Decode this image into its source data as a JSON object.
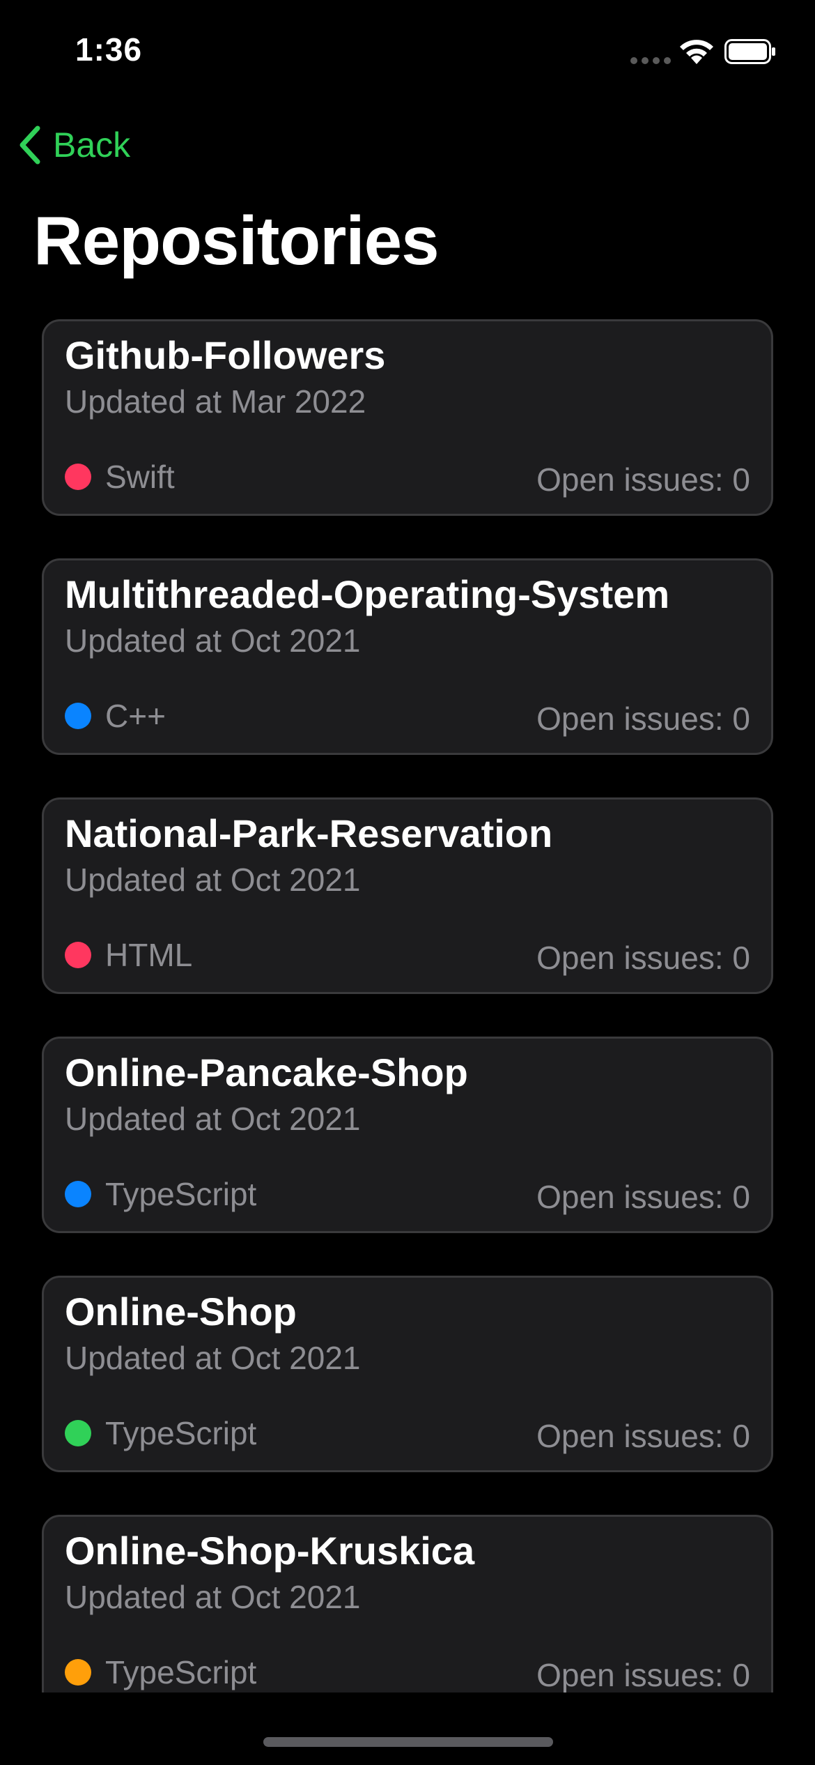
{
  "status_bar": {
    "time": "1:36"
  },
  "nav": {
    "back_label": "Back",
    "accent_color": "#30d158"
  },
  "page": {
    "title": "Repositories"
  },
  "repos": [
    {
      "name": "Github-Followers",
      "updated": "Updated at Mar 2022",
      "language": "Swift",
      "language_color": "#ff375f",
      "issues": "Open issues: 0"
    },
    {
      "name": "Multithreaded-Operating-System",
      "updated": "Updated at Oct 2021",
      "language": "C++",
      "language_color": "#0a84ff",
      "issues": "Open issues: 0"
    },
    {
      "name": "National-Park-Reservation",
      "updated": "Updated at Oct 2021",
      "language": "HTML",
      "language_color": "#ff375f",
      "issues": "Open issues: 0"
    },
    {
      "name": "Online-Pancake-Shop",
      "updated": "Updated at Oct 2021",
      "language": "TypeScript",
      "language_color": "#0a84ff",
      "issues": "Open issues: 0"
    },
    {
      "name": "Online-Shop",
      "updated": "Updated at Oct 2021",
      "language": "TypeScript",
      "language_color": "#30d158",
      "issues": "Open issues: 0"
    },
    {
      "name": "Online-Shop-Kruskica",
      "updated": "Updated at Oct 2021",
      "language": "TypeScript",
      "language_color": "#ff9f0a",
      "issues": "Open issues: 0"
    }
  ]
}
